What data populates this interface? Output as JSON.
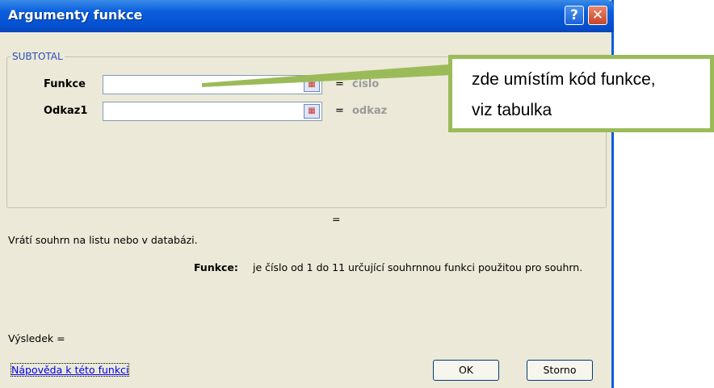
{
  "dialog": {
    "title": "Argumenty funkce",
    "help_glyph": "?",
    "close_glyph": "✕",
    "group_label": "SUBTOTAL",
    "args": [
      {
        "label": "Funkce",
        "value": "",
        "equals": "=",
        "hint": "číslo"
      },
      {
        "label": "Odkaz1",
        "value": "",
        "equals": "=",
        "hint": "odkaz"
      }
    ],
    "result_equals": "=",
    "description": "Vrátí souhrn na listu nebo v databázi.",
    "arg_help_label": "Funkce:",
    "arg_help_text": "je číslo od 1 do 11 určující souhrnnou funkci použitou pro souhrn.",
    "result_label": "Výsledek =",
    "help_link": "Nápověda k této funkci",
    "ok_label": "OK",
    "cancel_label": "Storno"
  },
  "callout": {
    "line1": "zde umístím kód funkce,",
    "line2": "viz tabulka",
    "color": "#9bbb59"
  },
  "colors": {
    "title_bar": "#0b5fdc",
    "dialog_bg": "#ece9d8"
  }
}
